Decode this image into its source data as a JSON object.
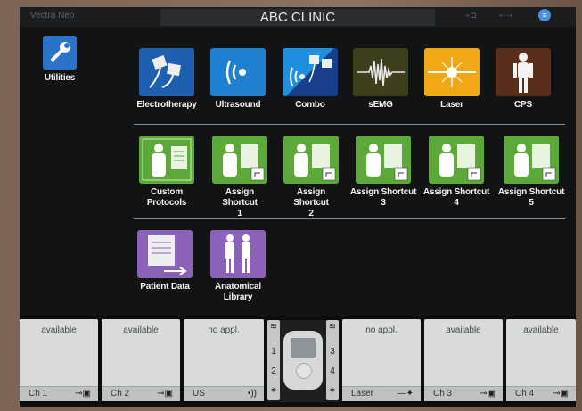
{
  "header": {
    "brand": "Vectra Neo",
    "title": "ABC CLINIC"
  },
  "utilities": {
    "label": "Utilities"
  },
  "row1": [
    {
      "label": "Electrotherapy",
      "color": "#1f5fb0"
    },
    {
      "label": "Ultrasound",
      "color": "#1f7fd0"
    },
    {
      "label": "Combo",
      "color": "#1f5fb0"
    },
    {
      "label": "sEMG",
      "color": "#4a4a1e"
    },
    {
      "label": "Laser",
      "color": "#f0a818"
    },
    {
      "label": "CPS",
      "color": "#6a3a1e"
    }
  ],
  "row2": [
    {
      "line1": "Custom",
      "line2": "Protocols"
    },
    {
      "line1": "Assign Shortcut",
      "line2": "1"
    },
    {
      "line1": "Assign Shortcut",
      "line2": "2"
    },
    {
      "line1": "Assign Shortcut",
      "line2": "3"
    },
    {
      "line1": "Assign Shortcut",
      "line2": "4"
    },
    {
      "line1": "Assign Shortcut",
      "line2": "5"
    }
  ],
  "row3": [
    {
      "line1": "Patient Data",
      "line2": ""
    },
    {
      "line1": "Anatomical",
      "line2": "Library"
    }
  ],
  "channels": [
    {
      "status": "available",
      "name": "Ch 1"
    },
    {
      "status": "available",
      "name": "Ch 2"
    },
    {
      "status": "no appl.",
      "name": "US"
    },
    {
      "status": "no appl.",
      "name": "Laser"
    },
    {
      "status": "available",
      "name": "Ch 3"
    },
    {
      "status": "available",
      "name": "Ch 4"
    }
  ],
  "pod": {
    "left_nums": [
      "1",
      "2"
    ],
    "right_nums": [
      "3",
      "4"
    ]
  }
}
